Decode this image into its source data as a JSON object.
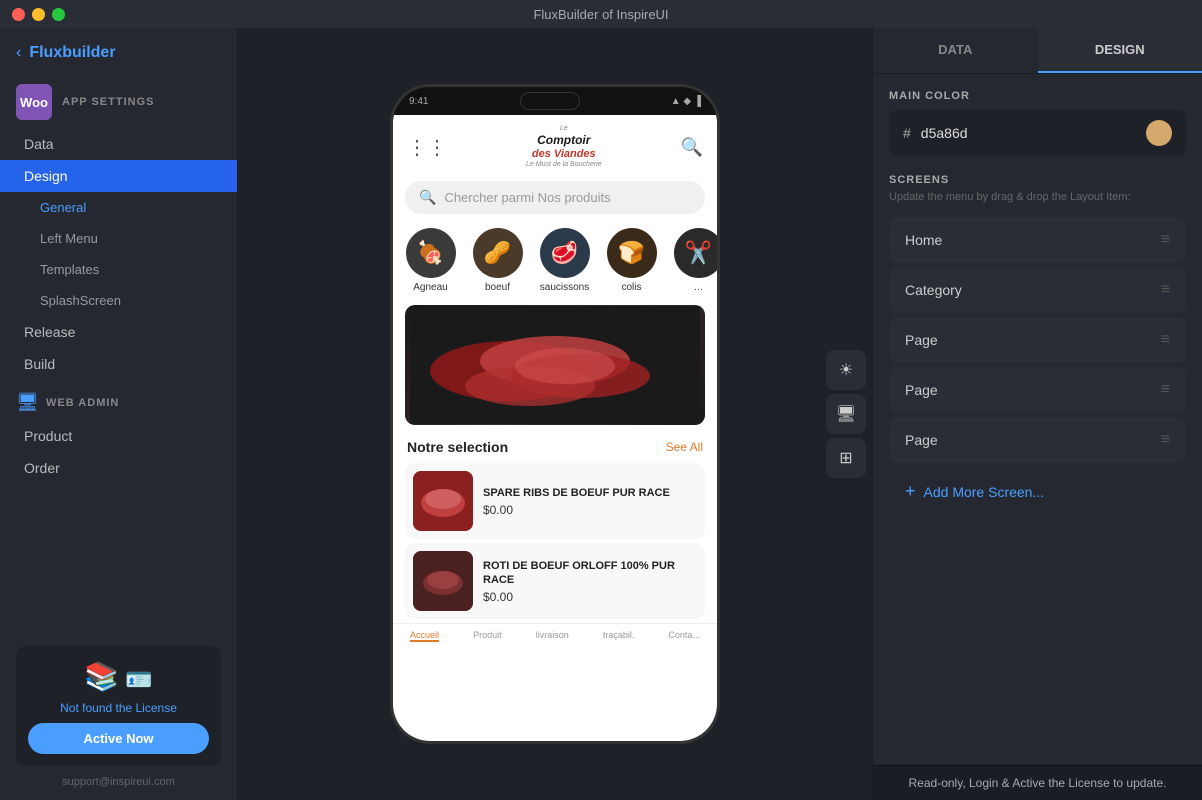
{
  "titlebar": {
    "title": "FluxBuilder of InspireUI"
  },
  "sidebar": {
    "back_label": "Fluxbuilder",
    "app_settings_label": "APP SETTINGS",
    "nav": {
      "data": "Data",
      "design": "Design",
      "general": "General",
      "left_menu": "Left Menu",
      "templates": "Templates",
      "splash_screen": "SplashScreen",
      "release": "Release",
      "build": "Build"
    },
    "web_admin_label": "WEB ADMIN",
    "web_admin_nav": {
      "product": "Product",
      "order": "Order"
    },
    "license": {
      "not_found_text": "Not found the License",
      "active_btn": "Active Now"
    },
    "support_email": "support@inspireui.com"
  },
  "phone": {
    "store_name_line1": "Le Comptoir",
    "store_name_line2": "des Viandes",
    "store_tagline": "Le Must de la Boucherie",
    "search_placeholder": "Chercher parmi Nos produits",
    "categories": [
      {
        "label": "Agneau",
        "emoji": "🍖"
      },
      {
        "label": "boeuf",
        "emoji": "🥜"
      },
      {
        "label": "saucissons",
        "emoji": "🥩"
      },
      {
        "label": "colis",
        "emoji": "🍞"
      },
      {
        "label": "...",
        "emoji": "✂️"
      }
    ],
    "section_title": "Notre selection",
    "see_all": "See All",
    "products": [
      {
        "name": "SPARE RIBS DE BOEUF PUR RACE",
        "price": "$0.00"
      },
      {
        "name": "ROTI DE BOEUF ORLOFF 100% PUR RACE",
        "price": "$0.00"
      }
    ],
    "bottom_nav": [
      {
        "label": "Accueil",
        "active": true
      },
      {
        "label": "Produit",
        "active": false
      },
      {
        "label": "livraison",
        "active": false
      },
      {
        "label": "traçabil.",
        "active": false
      },
      {
        "label": "Conta...",
        "active": false
      }
    ]
  },
  "toolbar": {
    "icons": [
      "☀",
      "🖥",
      "⊞"
    ]
  },
  "right_panel": {
    "tabs": [
      "DATA",
      "DESIGN"
    ],
    "active_tab": "DESIGN",
    "main_color_label": "MAIN COLOR",
    "color_value": "d5a86d",
    "color_hex": "#d5a86d",
    "screens_label": "SCREENS",
    "screens_hint": "Update the menu by drag & drop the Layout Item:",
    "screens": [
      {
        "label": "Home"
      },
      {
        "label": "Category"
      },
      {
        "label": "Page"
      },
      {
        "label": "Page"
      },
      {
        "label": "Page"
      }
    ],
    "add_screen_label": "Add More Screen...",
    "toast": "Read-only, Login & Active the License to update."
  }
}
